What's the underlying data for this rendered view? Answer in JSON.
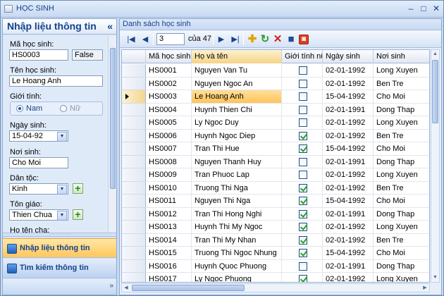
{
  "window": {
    "title": "HỌC SINH"
  },
  "left": {
    "header": "Nhập liệu thông tin",
    "collapse_glyph": "«",
    "labels": {
      "ma": "Mã học sinh:",
      "ten": "Tên học sinh:",
      "gioitinh": "Giới tính:",
      "ngaysinh": "Ngày sinh:",
      "noisinh": "Nơi sinh:",
      "dantoc": "Dân tộc:",
      "tongiao": "Tôn giáo:",
      "hotencha": "Họ tên cha:"
    },
    "values": {
      "ma": "HS0003",
      "flag": "False",
      "ten": "Le Hoang Anh",
      "ngaysinh": "15-04-92",
      "noisinh": "Cho Moi",
      "dantoc": "Kinh",
      "tongiao": "Thien Chua"
    },
    "gender": {
      "male": "Nam",
      "female": "Nữ",
      "selected": "Nam"
    },
    "nav": [
      {
        "label": "Nhập liệu thông tin",
        "active": true
      },
      {
        "label": "Tìm kiếm thông tin",
        "active": false
      }
    ]
  },
  "right": {
    "header": "Danh sách học sinh",
    "navigator": {
      "position": "3",
      "of": "của 47"
    },
    "columns": [
      "Mã học sinh",
      "Họ và tên",
      "Giới tính nữ",
      "Ngày sinh",
      "Nơi sinh"
    ],
    "rows": [
      {
        "ma": "HS0001",
        "ten": "Nguyen Van Tu",
        "nu": false,
        "ngay": "02-01-1992",
        "noi": "Long Xuyen"
      },
      {
        "ma": "HS0002",
        "ten": "Nguyen Ngoc An",
        "nu": false,
        "ngay": "02-01-1992",
        "noi": "Ben Tre"
      },
      {
        "ma": "HS0003",
        "ten": "Le Hoang Anh",
        "nu": false,
        "ngay": "15-04-1992",
        "noi": "Cho Moi"
      },
      {
        "ma": "HS0004",
        "ten": "Huynh Thien Chi",
        "nu": false,
        "ngay": "02-01-1991",
        "noi": "Dong Thap"
      },
      {
        "ma": "HS0005",
        "ten": "Ly Ngoc Duy",
        "nu": false,
        "ngay": "02-01-1992",
        "noi": "Long Xuyen"
      },
      {
        "ma": "HS0006",
        "ten": "Huynh Ngoc Diep",
        "nu": true,
        "ngay": "02-01-1992",
        "noi": "Ben Tre"
      },
      {
        "ma": "HS0007",
        "ten": "Tran Thi Hue",
        "nu": true,
        "ngay": "15-04-1992",
        "noi": "Cho Moi"
      },
      {
        "ma": "HS0008",
        "ten": "Nguyen Thanh Huy",
        "nu": false,
        "ngay": "02-01-1991",
        "noi": "Dong Thap"
      },
      {
        "ma": "HS0009",
        "ten": "Tran Phuoc Lap",
        "nu": false,
        "ngay": "02-01-1992",
        "noi": "Long Xuyen"
      },
      {
        "ma": "HS0010",
        "ten": "Truong Thi Nga",
        "nu": true,
        "ngay": "02-01-1992",
        "noi": "Ben Tre"
      },
      {
        "ma": "HS0011",
        "ten": "Nguyen Thi Nga",
        "nu": true,
        "ngay": "15-04-1992",
        "noi": "Cho Moi"
      },
      {
        "ma": "HS0012",
        "ten": "Tran Thi Hong Nghi",
        "nu": true,
        "ngay": "02-01-1991",
        "noi": "Dong Thap"
      },
      {
        "ma": "HS0013",
        "ten": "Huynh Thi My Ngoc",
        "nu": true,
        "ngay": "02-01-1992",
        "noi": "Long Xuyen"
      },
      {
        "ma": "HS0014",
        "ten": "Tran Thi My Nhan",
        "nu": true,
        "ngay": "02-01-1992",
        "noi": "Ben Tre"
      },
      {
        "ma": "HS0015",
        "ten": "Truong Thi Ngoc Nhung",
        "nu": true,
        "ngay": "15-04-1992",
        "noi": "Cho Moi"
      },
      {
        "ma": "HS0016",
        "ten": "Huynh Quoc Phuong",
        "nu": false,
        "ngay": "02-01-1991",
        "noi": "Dong Thap"
      },
      {
        "ma": "HS0017",
        "ten": "Ly Ngoc Phuong",
        "nu": true,
        "ngay": "02-01-1992",
        "noi": "Long Xuyen"
      }
    ],
    "current_row": 2
  },
  "colors": {
    "accent": "#15428b",
    "highlight": "#ffc45a",
    "check": "#21a121"
  }
}
